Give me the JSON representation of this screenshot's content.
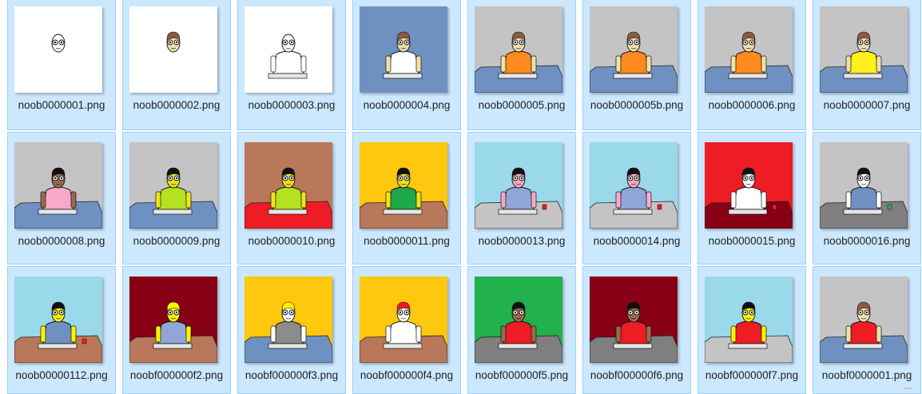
{
  "files": [
    {
      "name": "noob0000001.png",
      "bg": "#ffffff",
      "shirt": "none",
      "hair": "none",
      "skin": "#ffffff",
      "table": "none",
      "outline": true,
      "cup": "none"
    },
    {
      "name": "noob0000002.png",
      "bg": "#ffffff",
      "shirt": "none",
      "hair": "#8a5a44",
      "skin": "#efe0a8",
      "table": "none",
      "outline": false,
      "cup": "none"
    },
    {
      "name": "noob0000003.png",
      "bg": "#ffffff",
      "shirt": "#ffffff",
      "hair": "none",
      "skin": "#ffffff",
      "table": "none",
      "outline": true,
      "cup": "none"
    },
    {
      "name": "noob0000004.png",
      "bg": "#6f91c2",
      "shirt": "#ffffff",
      "hair": "#8a5a44",
      "skin": "#efe0a8",
      "table": "none",
      "outline": false,
      "cup": "none"
    },
    {
      "name": "noob0000005.png",
      "bg": "#c4c4c4",
      "shirt": "#ff8a1e",
      "hair": "#8a5a44",
      "skin": "#efe0a8",
      "table": "#6f91c2",
      "outline": false,
      "cup": "none"
    },
    {
      "name": "noob0000005b.png",
      "bg": "#c4c4c4",
      "shirt": "#ff8a1e",
      "hair": "#8a5a44",
      "skin": "#efe0a8",
      "table": "#6f91c2",
      "outline": false,
      "cup": "none"
    },
    {
      "name": "noob0000006.png",
      "bg": "#c4c4c4",
      "shirt": "#ff8a1e",
      "hair": "#8a5a44",
      "skin": "#efe0a8",
      "table": "#6f91c2",
      "outline": false,
      "cup": "none"
    },
    {
      "name": "noob0000007.png",
      "bg": "#c4c4c4",
      "shirt": "#fff01e",
      "hair": "#8a5a44",
      "skin": "#efe0a8",
      "table": "#6f91c2",
      "outline": false,
      "cup": "none"
    },
    {
      "name": "noob0000008.png",
      "bg": "#c4c4c4",
      "shirt": "#f7a9c9",
      "hair": "#111111",
      "skin": "#9a6a4e",
      "table": "#6f91c2",
      "outline": false,
      "cup": "none"
    },
    {
      "name": "noob0000009.png",
      "bg": "#c4c4c4",
      "shirt": "#b5e21e",
      "hair": "#111111",
      "skin": "#efe21e",
      "table": "#6f91c2",
      "outline": false,
      "cup": "none"
    },
    {
      "name": "noob0000010.png",
      "bg": "#b9785a",
      "shirt": "#b5e21e",
      "hair": "#111111",
      "skin": "#efe21e",
      "table": "#ee1c24",
      "outline": false,
      "cup": "none"
    },
    {
      "name": "noob0000011.png",
      "bg": "#ffc80e",
      "shirt": "#1fa84a",
      "hair": "#111111",
      "skin": "#efe21e",
      "table": "#b9785a",
      "outline": false,
      "cup": "none"
    },
    {
      "name": "noob0000013.png",
      "bg": "#99d9ea",
      "shirt": "#8fa6d6",
      "hair": "#111111",
      "skin": "#f7a9c9",
      "table": "#c4c4c4",
      "outline": false,
      "cup": "#ee1c24"
    },
    {
      "name": "noob0000014.png",
      "bg": "#99d9ea",
      "shirt": "#8fa6d6",
      "hair": "#111111",
      "skin": "#f7a9c9",
      "table": "#c4c4c4",
      "outline": false,
      "cup": "#ee1c24"
    },
    {
      "name": "noob0000015.png",
      "bg": "#ee1c24",
      "shirt": "#ffffff",
      "hair": "#111111",
      "skin": "#ffffff",
      "table": "#880015",
      "outline": false,
      "cup": "#ee1c24"
    },
    {
      "name": "noob0000016.png",
      "bg": "#c4c4c4",
      "shirt": "#6f91c2",
      "hair": "#111111",
      "skin": "#ffffff",
      "table": "#7f7f7f",
      "outline": false,
      "cup": "#22b14c"
    },
    {
      "name": "noob00000112.png",
      "bg": "#99d9ea",
      "shirt": "#6f91c2",
      "hair": "#111111",
      "skin": "#fff200",
      "table": "#b9785a",
      "outline": false,
      "cup": "#ee1c24"
    },
    {
      "name": "noobf000000f2.png",
      "bg": "#880015",
      "shirt": "#8fa6d6",
      "hair": "#fff200",
      "skin": "#fff200",
      "table": "#b9785a",
      "outline": false,
      "cup": "none"
    },
    {
      "name": "noobf000000f3.png",
      "bg": "#ffc80e",
      "shirt": "#8c8c8c",
      "hair": "#fff200",
      "skin": "#ffffff",
      "table": "#6f91c2",
      "outline": false,
      "cup": "none"
    },
    {
      "name": "noobf000000f4.png",
      "bg": "#ffc80e",
      "shirt": "#ffffff",
      "hair": "#ee1c24",
      "skin": "#ffffff",
      "table": "#b9785a",
      "outline": false,
      "cup": "none"
    },
    {
      "name": "noobf000000f5.png",
      "bg": "#22b14c",
      "shirt": "#ee1c24",
      "hair": "#111111",
      "skin": "#9a6a4e",
      "table": "#7f7f7f",
      "outline": false,
      "cup": "none"
    },
    {
      "name": "noobf000000f6.png",
      "bg": "#880015",
      "shirt": "#ee1c24",
      "hair": "#111111",
      "skin": "#9a6a4e",
      "table": "#7f7f7f",
      "outline": false,
      "cup": "none"
    },
    {
      "name": "noobf000000f7.png",
      "bg": "#99d9ea",
      "shirt": "#ee1c24",
      "hair": "#111111",
      "skin": "#fff200",
      "table": "#c4c4c4",
      "outline": false,
      "cup": "none"
    },
    {
      "name": "noobf0000001.png",
      "bg": "#c4c4c4",
      "shirt": "#ee1c24",
      "hair": "#8a5a44",
      "skin": "#efe0a8",
      "table": "#6f91c2",
      "outline": false,
      "cup": "none"
    }
  ]
}
